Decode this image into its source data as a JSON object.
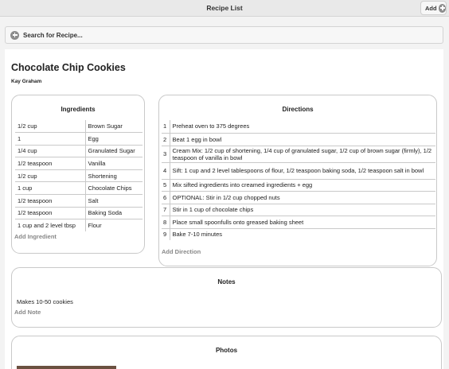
{
  "header": {
    "title": "Recipe List",
    "add_label": "Add"
  },
  "search": {
    "label": "Search for Recipe..."
  },
  "recipe": {
    "title": "Chocolate Chip Cookies",
    "author": "Kay Graham"
  },
  "ingredients": {
    "title": "Ingredients",
    "rows": [
      [
        "1/2 cup",
        "Brown Sugar"
      ],
      [
        "1",
        "Egg"
      ],
      [
        "1/4 cup",
        "Granulated Sugar"
      ],
      [
        "1/2 teaspoon",
        "Vanilla"
      ],
      [
        "1/2 cup",
        "Shortening"
      ],
      [
        "1 cup",
        "Chocolate Chips"
      ],
      [
        "1/2 teaspoon",
        "Salt"
      ],
      [
        "1/2 teaspoon",
        "Baking Soda"
      ],
      [
        "1 cup and 2 level tbsp",
        "Flour"
      ]
    ],
    "add_label": "Add Ingredient"
  },
  "directions": {
    "title": "Directions",
    "rows": [
      [
        "1",
        "Preheat oven to 375 degrees"
      ],
      [
        "2",
        "Beat 1 egg in bowl"
      ],
      [
        "3",
        "Cream Mix: 1/2 cup of shortening, 1/4 cup of granulated sugar, 1/2 cup of brown sugar (firmly), 1/2 teaspoon of vanilla in bowl"
      ],
      [
        "4",
        "Sift: 1 cup and 2 level tablespoons of flour, 1/2 teaspoon baking soda, 1/2 teaspoon salt in bowl"
      ],
      [
        "5",
        "Mix sifted ingredients into creamed ingredients + egg"
      ],
      [
        "6",
        "OPTIONAL: Stir in 1/2 cup chopped nuts"
      ],
      [
        "7",
        "Stir in 1 cup of chocolate chips"
      ],
      [
        "8",
        "Place small spoonfulls onto greased baking sheet"
      ],
      [
        "9",
        "Bake 7-10 minutes"
      ]
    ],
    "add_label": "Add Direction"
  },
  "notes": {
    "title": "Notes",
    "items": [
      "Makes 10-50 cookies"
    ],
    "add_label": "Add Note"
  },
  "photos": {
    "title": "Photos"
  }
}
